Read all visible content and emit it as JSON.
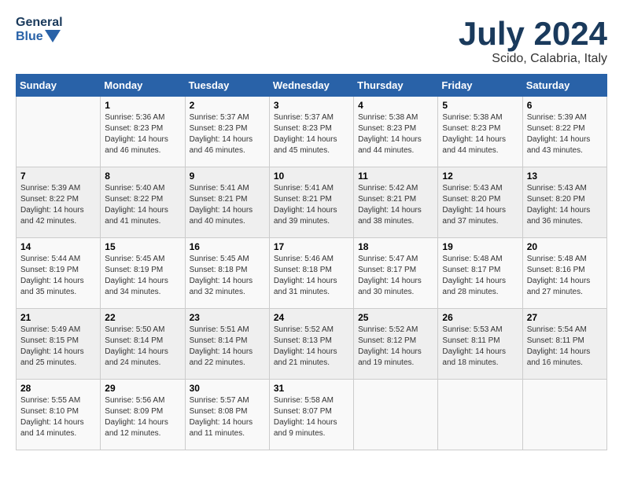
{
  "header": {
    "logo_line1": "General",
    "logo_line2": "Blue",
    "month_title": "July 2024",
    "subtitle": "Scido, Calabria, Italy"
  },
  "weekdays": [
    "Sunday",
    "Monday",
    "Tuesday",
    "Wednesday",
    "Thursday",
    "Friday",
    "Saturday"
  ],
  "weeks": [
    [
      {
        "day": "",
        "info": ""
      },
      {
        "day": "1",
        "info": "Sunrise: 5:36 AM\nSunset: 8:23 PM\nDaylight: 14 hours\nand 46 minutes."
      },
      {
        "day": "2",
        "info": "Sunrise: 5:37 AM\nSunset: 8:23 PM\nDaylight: 14 hours\nand 46 minutes."
      },
      {
        "day": "3",
        "info": "Sunrise: 5:37 AM\nSunset: 8:23 PM\nDaylight: 14 hours\nand 45 minutes."
      },
      {
        "day": "4",
        "info": "Sunrise: 5:38 AM\nSunset: 8:23 PM\nDaylight: 14 hours\nand 44 minutes."
      },
      {
        "day": "5",
        "info": "Sunrise: 5:38 AM\nSunset: 8:23 PM\nDaylight: 14 hours\nand 44 minutes."
      },
      {
        "day": "6",
        "info": "Sunrise: 5:39 AM\nSunset: 8:22 PM\nDaylight: 14 hours\nand 43 minutes."
      }
    ],
    [
      {
        "day": "7",
        "info": "Sunrise: 5:39 AM\nSunset: 8:22 PM\nDaylight: 14 hours\nand 42 minutes."
      },
      {
        "day": "8",
        "info": "Sunrise: 5:40 AM\nSunset: 8:22 PM\nDaylight: 14 hours\nand 41 minutes."
      },
      {
        "day": "9",
        "info": "Sunrise: 5:41 AM\nSunset: 8:21 PM\nDaylight: 14 hours\nand 40 minutes."
      },
      {
        "day": "10",
        "info": "Sunrise: 5:41 AM\nSunset: 8:21 PM\nDaylight: 14 hours\nand 39 minutes."
      },
      {
        "day": "11",
        "info": "Sunrise: 5:42 AM\nSunset: 8:21 PM\nDaylight: 14 hours\nand 38 minutes."
      },
      {
        "day": "12",
        "info": "Sunrise: 5:43 AM\nSunset: 8:20 PM\nDaylight: 14 hours\nand 37 minutes."
      },
      {
        "day": "13",
        "info": "Sunrise: 5:43 AM\nSunset: 8:20 PM\nDaylight: 14 hours\nand 36 minutes."
      }
    ],
    [
      {
        "day": "14",
        "info": "Sunrise: 5:44 AM\nSunset: 8:19 PM\nDaylight: 14 hours\nand 35 minutes."
      },
      {
        "day": "15",
        "info": "Sunrise: 5:45 AM\nSunset: 8:19 PM\nDaylight: 14 hours\nand 34 minutes."
      },
      {
        "day": "16",
        "info": "Sunrise: 5:45 AM\nSunset: 8:18 PM\nDaylight: 14 hours\nand 32 minutes."
      },
      {
        "day": "17",
        "info": "Sunrise: 5:46 AM\nSunset: 8:18 PM\nDaylight: 14 hours\nand 31 minutes."
      },
      {
        "day": "18",
        "info": "Sunrise: 5:47 AM\nSunset: 8:17 PM\nDaylight: 14 hours\nand 30 minutes."
      },
      {
        "day": "19",
        "info": "Sunrise: 5:48 AM\nSunset: 8:17 PM\nDaylight: 14 hours\nand 28 minutes."
      },
      {
        "day": "20",
        "info": "Sunrise: 5:48 AM\nSunset: 8:16 PM\nDaylight: 14 hours\nand 27 minutes."
      }
    ],
    [
      {
        "day": "21",
        "info": "Sunrise: 5:49 AM\nSunset: 8:15 PM\nDaylight: 14 hours\nand 25 minutes."
      },
      {
        "day": "22",
        "info": "Sunrise: 5:50 AM\nSunset: 8:14 PM\nDaylight: 14 hours\nand 24 minutes."
      },
      {
        "day": "23",
        "info": "Sunrise: 5:51 AM\nSunset: 8:14 PM\nDaylight: 14 hours\nand 22 minutes."
      },
      {
        "day": "24",
        "info": "Sunrise: 5:52 AM\nSunset: 8:13 PM\nDaylight: 14 hours\nand 21 minutes."
      },
      {
        "day": "25",
        "info": "Sunrise: 5:52 AM\nSunset: 8:12 PM\nDaylight: 14 hours\nand 19 minutes."
      },
      {
        "day": "26",
        "info": "Sunrise: 5:53 AM\nSunset: 8:11 PM\nDaylight: 14 hours\nand 18 minutes."
      },
      {
        "day": "27",
        "info": "Sunrise: 5:54 AM\nSunset: 8:11 PM\nDaylight: 14 hours\nand 16 minutes."
      }
    ],
    [
      {
        "day": "28",
        "info": "Sunrise: 5:55 AM\nSunset: 8:10 PM\nDaylight: 14 hours\nand 14 minutes."
      },
      {
        "day": "29",
        "info": "Sunrise: 5:56 AM\nSunset: 8:09 PM\nDaylight: 14 hours\nand 12 minutes."
      },
      {
        "day": "30",
        "info": "Sunrise: 5:57 AM\nSunset: 8:08 PM\nDaylight: 14 hours\nand 11 minutes."
      },
      {
        "day": "31",
        "info": "Sunrise: 5:58 AM\nSunset: 8:07 PM\nDaylight: 14 hours\nand 9 minutes."
      },
      {
        "day": "",
        "info": ""
      },
      {
        "day": "",
        "info": ""
      },
      {
        "day": "",
        "info": ""
      }
    ]
  ]
}
